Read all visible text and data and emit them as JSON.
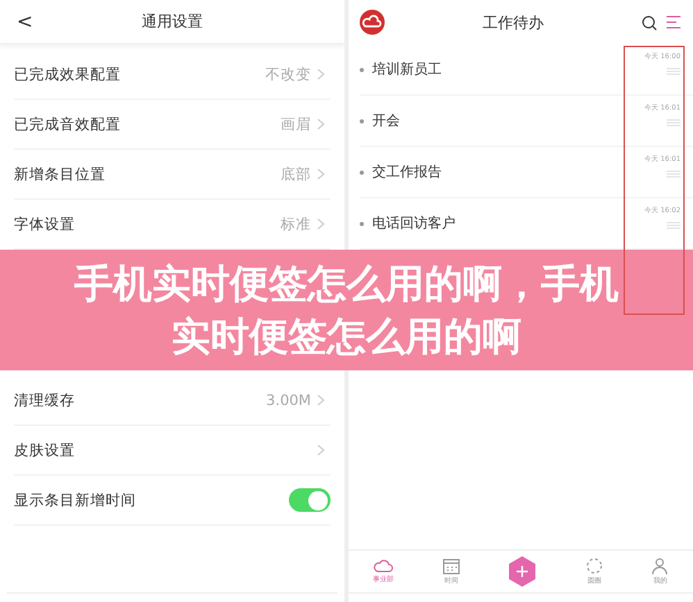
{
  "settings_screen": {
    "back": "<",
    "title": "通用设置",
    "rows": [
      {
        "kind": "value",
        "label": "已完成效果配置",
        "value": "不改变"
      },
      {
        "kind": "value",
        "label": "已完成音效配置",
        "value": "画眉"
      },
      {
        "kind": "value",
        "label": "新增条目位置",
        "value": "底部"
      },
      {
        "kind": "value",
        "label": "字体设置",
        "value": "标准"
      }
    ],
    "lower_rows": [
      {
        "kind": "value",
        "label": "清理缓存",
        "value": "3.00M"
      },
      {
        "kind": "link",
        "label": "皮肤设置"
      },
      {
        "kind": "toggle",
        "label": "显示条目新增时间",
        "on": true
      }
    ]
  },
  "todo_screen": {
    "title": "工作待办",
    "items": [
      {
        "title": "培训新员工",
        "time": "今天 16:00"
      },
      {
        "title": "开会",
        "time": "今天 16:01"
      },
      {
        "title": "交工作报告",
        "time": "今天 16:01"
      },
      {
        "title": "电话回访客户",
        "time": "今天 16:02"
      }
    ],
    "tabs": [
      {
        "kind": "cloud",
        "label": "事业部",
        "selected": true
      },
      {
        "kind": "calendar",
        "label": "时间",
        "selected": false
      },
      {
        "kind": "add"
      },
      {
        "kind": "circle",
        "label": "圆圈",
        "selected": false
      },
      {
        "kind": "user",
        "label": "我的",
        "selected": false
      }
    ]
  },
  "banner": {
    "title": "手机实时便签怎么用的啊，手机实时便签怎么用的啊"
  }
}
